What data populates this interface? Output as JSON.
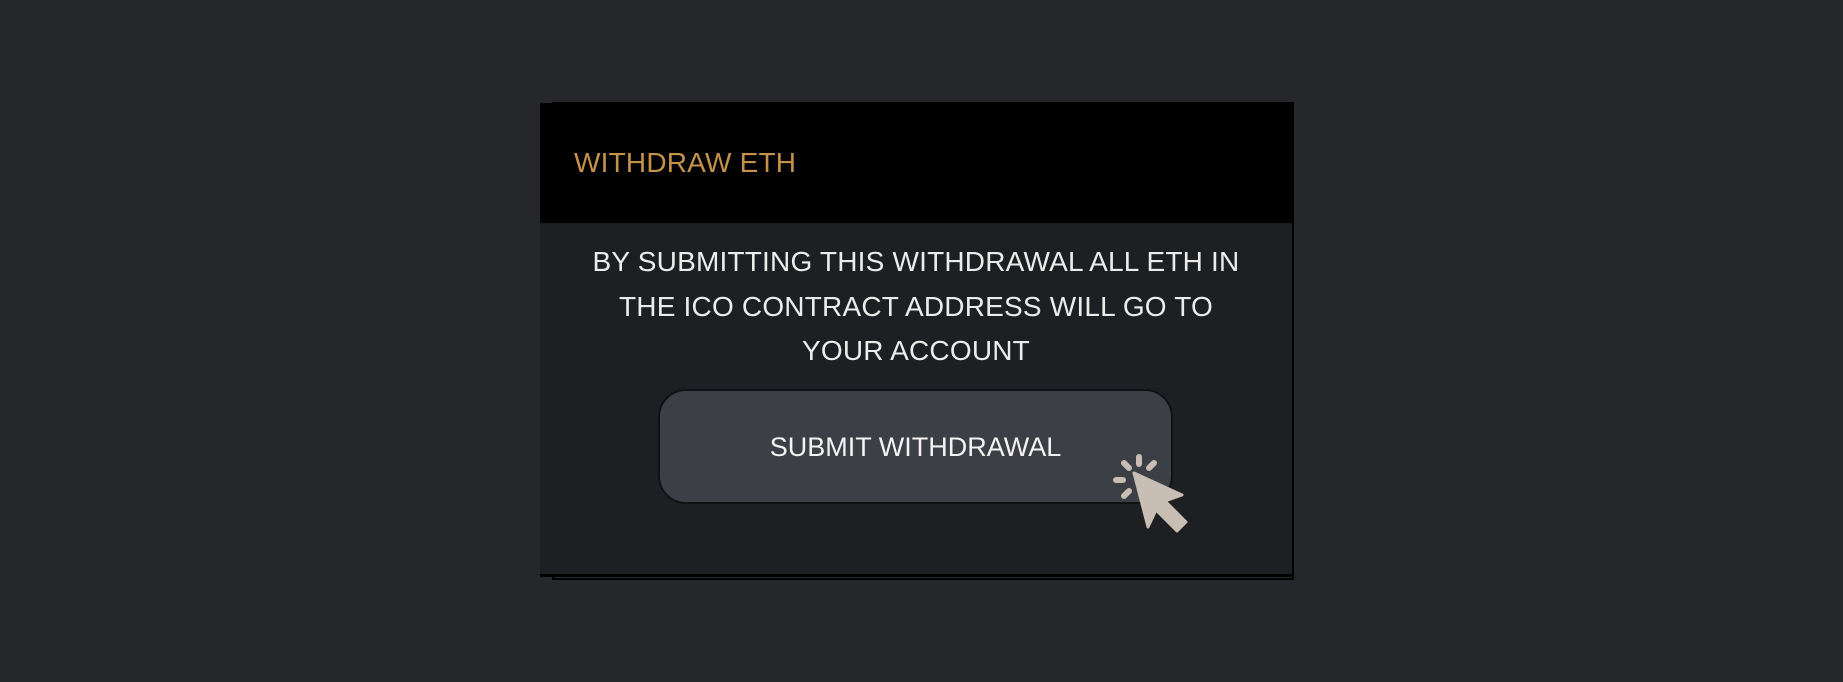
{
  "dialog": {
    "title": "WITHDRAW ETH",
    "message": "BY SUBMITTING THIS WITHDRAWAL ALL ETH IN THE ICO CONTRACT ADDRESS WILL GO TO YOUR ACCOUNT",
    "submit_label": "SUBMIT WITHDRAWAL"
  },
  "colors": {
    "page_background": "#26272b",
    "header_background": "#000000",
    "body_background": "#1e1f22",
    "title_accent": "#c5924a",
    "button_background": "#3d3f46",
    "cursor": "#c8beb4"
  },
  "icons": {
    "cursor": "click-cursor-icon"
  }
}
